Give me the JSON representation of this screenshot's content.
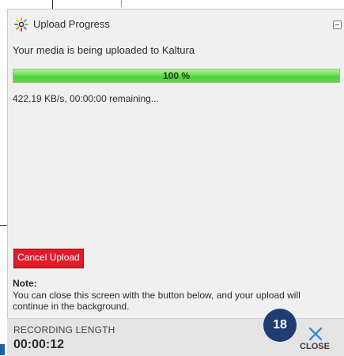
{
  "dialog": {
    "title": "Upload Progress",
    "status_message": "Your media is being uploaded to Kaltura",
    "progress": {
      "percent": 100,
      "label": "100 %"
    },
    "transfer_info": "422.19 KB/s, 00:00:00 remaining...",
    "cancel_label": "Cancel Upload",
    "note": {
      "title": "Note:",
      "body": "You can close this screen with the button below, and your upload will continue in the background."
    }
  },
  "footer": {
    "recording_length_label": "RECORDING LENGTH",
    "recording_length_value": "00:00:12",
    "step_badge": "18",
    "close_label": "CLOSE"
  },
  "icons": {
    "logo": "kaltura-logo-icon",
    "minimize": "minimize-icon",
    "close": "close-icon"
  },
  "colors": {
    "progress_fill": "#4fcf3a",
    "cancel_button": "#e01b2a",
    "close_accent": "#3a8ddc",
    "badge": "#1f3c73"
  }
}
